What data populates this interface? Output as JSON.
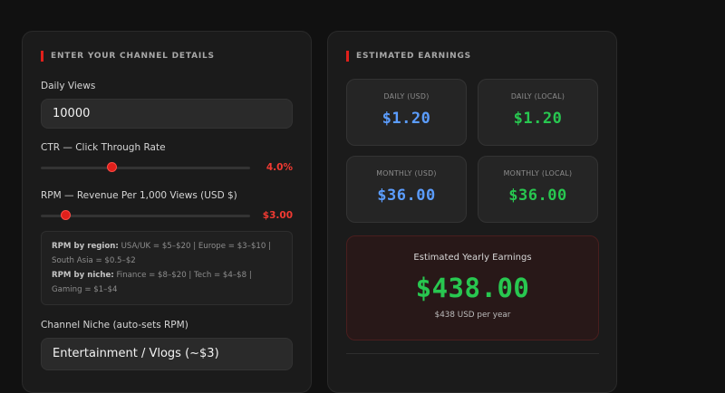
{
  "input_panel": {
    "title": "ENTER YOUR CHANNEL DETAILS",
    "daily_views_label": "Daily Views",
    "daily_views_value": "10000",
    "ctr_label": "CTR — Click Through Rate",
    "ctr_value": "4.0%",
    "ctr_fraction": 0.34,
    "rpm_label": "RPM — Revenue Per 1,000 Views (USD $)",
    "rpm_value": "$3.00",
    "rpm_fraction": 0.12,
    "info": {
      "region_heading": "RPM by region:",
      "region_text": "USA/UK = $5–$20  |  Europe = $3–$10  |  South Asia = $0.5–$2",
      "niche_heading": "RPM by niche:",
      "niche_text": "Finance = $8–$20  |  Tech = $4–$8  |  Gaming = $1–$4"
    },
    "niche_label": "Channel Niche (auto-sets RPM)",
    "niche_value": "Entertainment / Vlogs (~$3)"
  },
  "results_panel": {
    "title": "ESTIMATED EARNINGS",
    "daily_usd_label": "DAILY (USD)",
    "daily_usd_value": "$1.20",
    "daily_local_label": "DAILY (LOCAL)",
    "daily_local_value": "$1.20",
    "monthly_usd_label": "MONTHLY (USD)",
    "monthly_usd_value": "$36.00",
    "monthly_local_label": "MONTHLY (LOCAL)",
    "monthly_local_value": "$36.00",
    "yearly_label": "Estimated Yearly Earnings",
    "yearly_value": "$438.00",
    "yearly_sub": "$438 USD per year"
  },
  "colors": {
    "accent": "#e0201b",
    "usd_blue": "#5b9dff",
    "local_green": "#28c750"
  }
}
